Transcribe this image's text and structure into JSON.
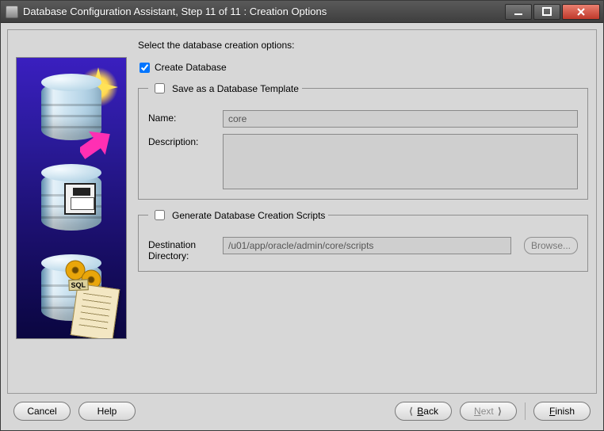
{
  "titlebar": {
    "title": "Database Configuration Assistant, Step 11 of 11 : Creation Options"
  },
  "main": {
    "prompt": "Select the database creation options:",
    "create_db_label": "Create Database",
    "create_db_checked": true,
    "template_group": {
      "legend": "Save as a Database Template",
      "checked": false,
      "name_label": "Name:",
      "name_value": "core",
      "description_label": "Description:",
      "description_value": ""
    },
    "scripts_group": {
      "legend": "Generate Database Creation Scripts",
      "checked": false,
      "dest_label_line1": "Destination",
      "dest_label_line2": "Directory:",
      "dest_value": "/u01/app/oracle/admin/core/scripts",
      "browse_label": "Browse..."
    }
  },
  "buttons": {
    "cancel": "Cancel",
    "help": "Help",
    "back": "Back",
    "next": "Next",
    "finish": "Finish"
  }
}
